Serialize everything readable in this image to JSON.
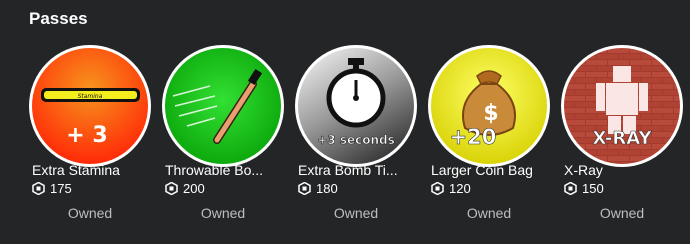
{
  "section": {
    "title": "Passes"
  },
  "colors": {
    "background": "#232527",
    "text": "#ffffff",
    "muted": "#bdbebe"
  },
  "passes": [
    {
      "name": "Extra Stamina",
      "price": "175",
      "status": "Owned",
      "icon": "stamina-bar-icon",
      "thumb_text": "+ 3",
      "bar_label": "Stamina",
      "thumb_colors": [
        "#f7941d",
        "#ff3c0a"
      ]
    },
    {
      "name": "Throwable Bo...",
      "price": "200",
      "status": "Owned",
      "icon": "throwing-stick-icon",
      "thumb_colors": [
        "#2bd32b",
        "#0aa00a"
      ]
    },
    {
      "name": "Extra Bomb Ti...",
      "price": "180",
      "status": "Owned",
      "icon": "stopwatch-icon",
      "thumb_text": "+3 seconds",
      "thumb_colors": [
        "#f0f0f0",
        "#5a5a5a"
      ]
    },
    {
      "name": "Larger Coin Bag",
      "price": "120",
      "status": "Owned",
      "icon": "money-bag-icon",
      "thumb_text": "+20",
      "thumb_colors": [
        "#ffff55",
        "#d8d800"
      ]
    },
    {
      "name": "X-Ray",
      "price": "150",
      "status": "Owned",
      "icon": "xray-brick-icon",
      "thumb_text": "X-RAY",
      "thumb_colors": [
        "#b5473a",
        "#7a2a22"
      ]
    }
  ]
}
